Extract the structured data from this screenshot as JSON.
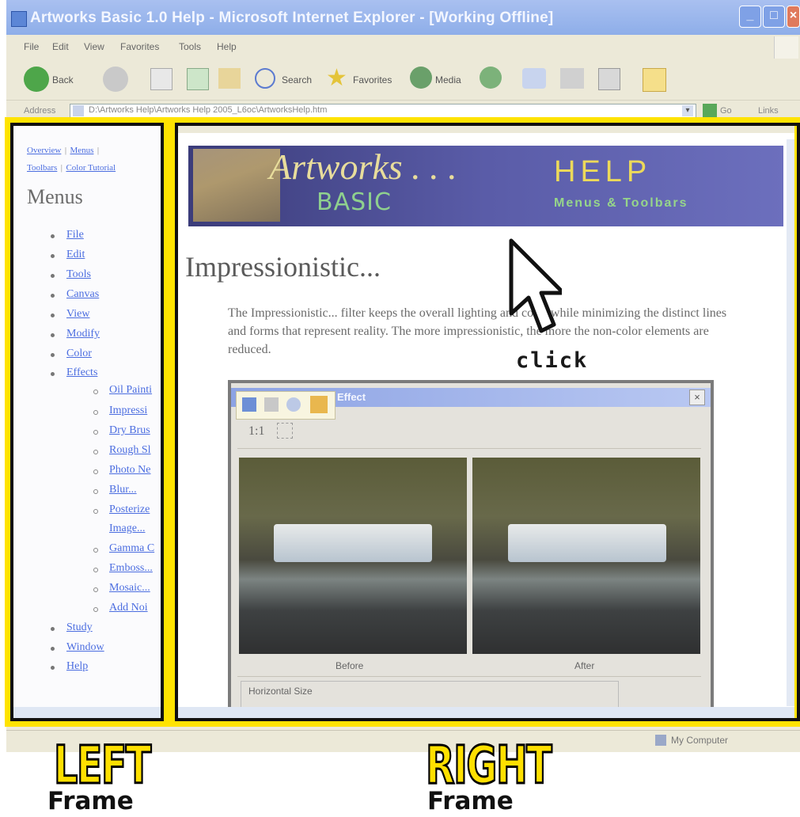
{
  "window": {
    "title": "Artworks Basic 1.0 Help - Microsoft Internet Explorer - [Working Offline]",
    "menu": [
      "File",
      "Edit",
      "View",
      "Favorites",
      "Tools",
      "Help"
    ],
    "toolbar": {
      "back": "Back",
      "search": "Search",
      "favorites": "Favorites",
      "media": "Media"
    },
    "address_label": "Address",
    "address": "D:\\Artworks Help\\Artworks Help 2005_L6oc\\ArtworksHelp.htm",
    "go": "Go",
    "links": "Links",
    "status": "My Computer"
  },
  "left_frame": {
    "top_links": [
      "Overview",
      "Menus",
      "Toolbars",
      "Color Tutorial"
    ],
    "heading": "Menus",
    "items": [
      "File",
      "Edit",
      "Tools",
      "Canvas",
      "View",
      "Modify",
      "Color",
      "Effects",
      "Study",
      "Window",
      "Help"
    ],
    "effects_sub": [
      "Oil Painti",
      "Impressi",
      "Dry Brus",
      "Rough Sl",
      "Photo Ne",
      "Blur...",
      "Posterize",
      "Image...",
      "Gamma C",
      "Emboss...",
      "Mosaic...",
      "Add Noi"
    ]
  },
  "right_frame": {
    "banner": {
      "artworks": "Artworks . . .",
      "basic": "BASIC",
      "help": "HELP",
      "subtitle": "Menus & Toolbars"
    },
    "page_title": "Impressionistic...",
    "description": "The Impressionistic... filter keeps the overall lighting and color while minimizing the distinct lines and forms that represent reality.  The more impressionistic, the more the non-color elements are reduced.",
    "dialog": {
      "title": "Effect",
      "zoom": "1:1",
      "before": "Before",
      "after": "After",
      "horizontal_size": "Horizontal Size"
    }
  },
  "annotations": {
    "click": "click",
    "left": "LEFT",
    "right": "RIGHT",
    "frame": "Frame",
    "highlight_color": "#ffe300"
  }
}
